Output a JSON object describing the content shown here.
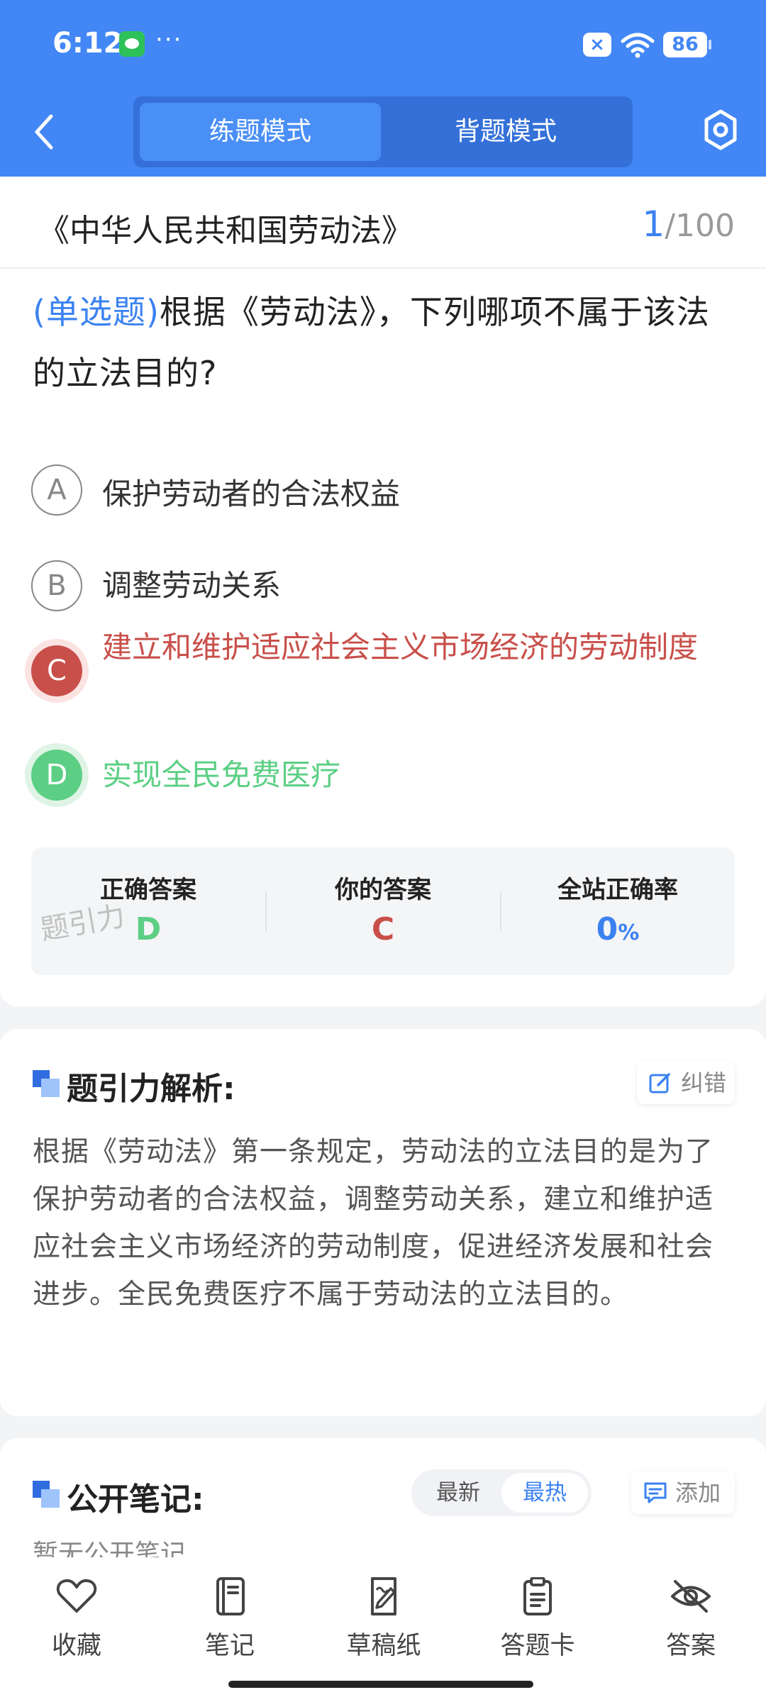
{
  "status_bar": {
    "time": "6:12",
    "dots": "···",
    "mute": "×",
    "battery": "86"
  },
  "header": {
    "modes": [
      {
        "label": "练题模式"
      },
      {
        "label": "背题模式"
      }
    ],
    "icons": {
      "back": "chevron-left-icon",
      "settings": "hexagon-settings-icon"
    }
  },
  "question_header": {
    "title": "《中华人民共和国劳动法》",
    "current": "1",
    "total": "/100"
  },
  "question": {
    "type": "(单选题)",
    "text": "根据《劳动法》，下列哪项不属于该法的立法目的?",
    "options": [
      {
        "key": "A",
        "text": "保护劳动者的合法权益"
      },
      {
        "key": "B",
        "text": "调整劳动关系"
      },
      {
        "key": "C",
        "text": "建立和维护适应社会主义市场经济的劳动制度"
      },
      {
        "key": "D",
        "text": "实现全民免费医疗"
      }
    ]
  },
  "colors": {
    "primary": "#4287f5",
    "wrong": "#c94f4a",
    "correct": "#5ccf84"
  },
  "result": {
    "correct_label": "正确答案",
    "correct_value": "D",
    "yours_label": "你的答案",
    "yours_value": "C",
    "rate_label": "全站正确率",
    "rate_value": "0",
    "rate_unit": "%",
    "watermark": "题引力"
  },
  "analysis": {
    "title": "题引力解析:",
    "report_button": "纠错",
    "text": "根据《劳动法》第一条规定，劳动法的立法目的是为了保护劳动者的合法权益，调整劳动关系，建立和维护适应社会主义市场经济的劳动制度，促进经济发展和社会进步。全民免费医疗不属于劳动法的立法目的。"
  },
  "notes": {
    "title": "公开笔记:",
    "sort_options": [
      "最新",
      "最热"
    ],
    "add_button": "添加",
    "empty": "暂无公开笔记"
  },
  "bottom_nav": [
    {
      "label": "收藏",
      "icon": "heart-icon"
    },
    {
      "label": "笔记",
      "icon": "notebook-icon"
    },
    {
      "label": "草稿纸",
      "icon": "draft-icon"
    },
    {
      "label": "答题卡",
      "icon": "clipboard-icon"
    },
    {
      "label": "答案",
      "icon": "eye-off-icon"
    }
  ]
}
